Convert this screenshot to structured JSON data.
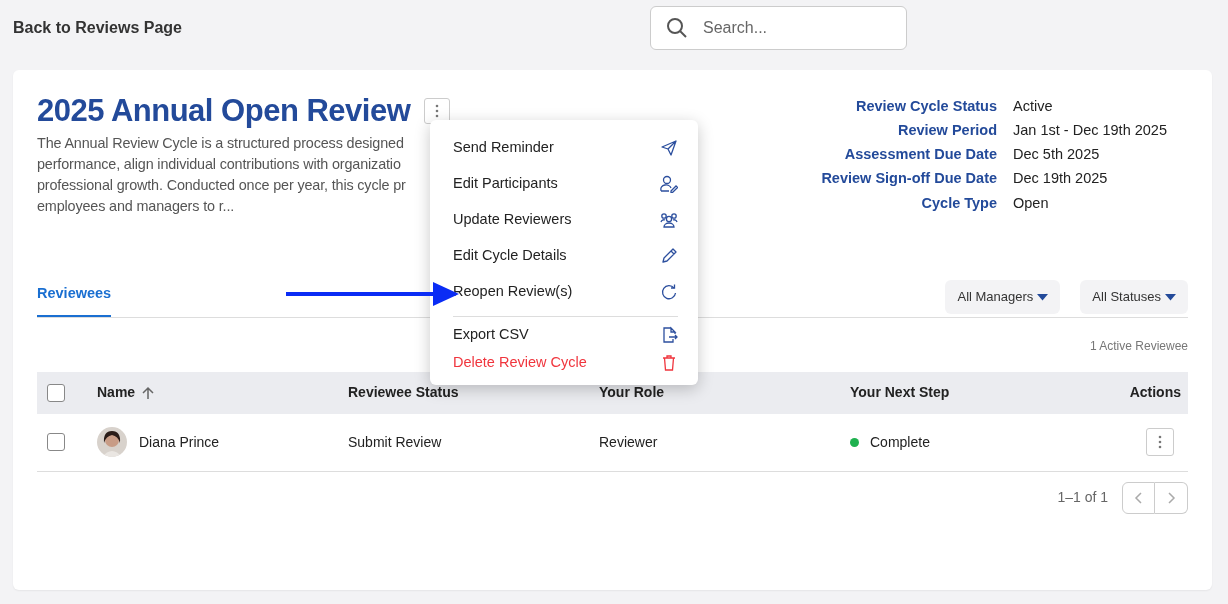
{
  "back_link": "Back to Reviews Page",
  "search": {
    "placeholder": "Search..."
  },
  "cycle": {
    "title": "2025 Annual Open Review",
    "description_lines": [
      "The Annual Review Cycle is a structured process designed",
      "performance, align individual contributions with organizatio",
      "professional growth. Conducted once per year, this cycle pr",
      "employees and managers to r..."
    ],
    "details": [
      {
        "label": "Review Cycle Status",
        "value": "Active"
      },
      {
        "label": "Review Period",
        "value": "Jan 1st - Dec 19th 2025"
      },
      {
        "label": "Assessment Due Date",
        "value": "Dec 5th 2025"
      },
      {
        "label": "Review Sign-off Due Date",
        "value": "Dec 19th 2025"
      },
      {
        "label": "Cycle Type",
        "value": "Open"
      }
    ]
  },
  "menu": {
    "groups": [
      [
        {
          "label": "Send Reminder",
          "kind": "normal"
        },
        {
          "label": "Edit Participants",
          "kind": "normal"
        },
        {
          "label": "Update Reviewers",
          "kind": "normal"
        },
        {
          "label": "Edit Cycle Details",
          "kind": "normal"
        },
        {
          "label": "Reopen Review(s)",
          "kind": "normal"
        }
      ],
      [
        {
          "label": "Export CSV",
          "kind": "normal"
        },
        {
          "label": "Delete Review Cycle",
          "kind": "danger"
        }
      ]
    ]
  },
  "tabs": [
    {
      "label": "Reviewees",
      "selected": true
    }
  ],
  "filters": [
    {
      "label": "All Managers"
    },
    {
      "label": "All Statuses"
    }
  ],
  "count_label": "1 Active Reviewee",
  "table": {
    "select_all_checked": false,
    "columns": [
      "Name",
      "Reviewee Status",
      "Your Role",
      "Your Next Step",
      "Actions"
    ],
    "rows": [
      {
        "checked": false,
        "name": "Diana Prince",
        "status": "Submit Review",
        "role": "Reviewer",
        "next_step": "Complete",
        "color": "#1fb14f"
      }
    ]
  },
  "pagination": {
    "range": "1–1 of 1",
    "prev_disabled": true,
    "next_disabled": true
  }
}
